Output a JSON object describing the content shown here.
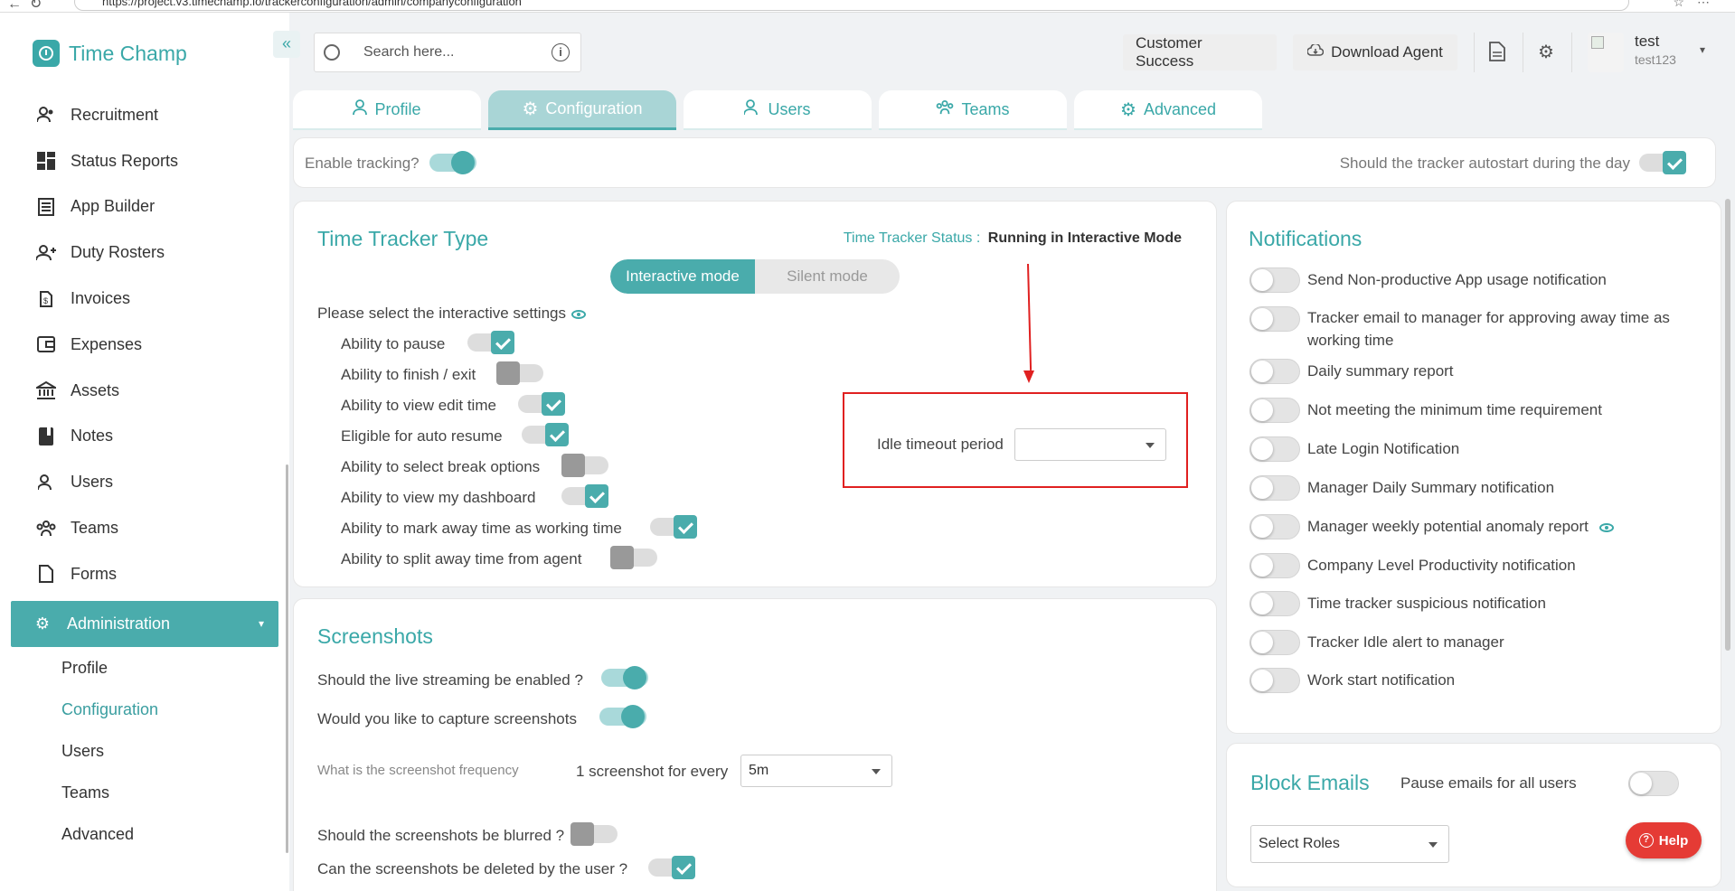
{
  "browser": {
    "url": "https://project.v3.timechamp.io/trackerconfiguration/admin/companyconfiguration"
  },
  "brand": {
    "name": "Time Champ"
  },
  "sidebar": {
    "items": [
      {
        "label": "Recruitment",
        "icon": "recruitment-icon"
      },
      {
        "label": "Status Reports",
        "icon": "status-reports-icon"
      },
      {
        "label": "App Builder",
        "icon": "app-builder-icon"
      },
      {
        "label": "Duty Rosters",
        "icon": "duty-rosters-icon"
      },
      {
        "label": "Invoices",
        "icon": "invoices-icon"
      },
      {
        "label": "Expenses",
        "icon": "expenses-icon"
      },
      {
        "label": "Assets",
        "icon": "assets-icon"
      },
      {
        "label": "Notes",
        "icon": "notes-icon"
      },
      {
        "label": "Users",
        "icon": "users-icon"
      },
      {
        "label": "Teams",
        "icon": "teams-icon"
      },
      {
        "label": "Forms",
        "icon": "forms-icon"
      }
    ],
    "active": {
      "label": "Administration",
      "icon": "gear-icon"
    },
    "sub": [
      "Profile",
      "Configuration",
      "Users",
      "Teams",
      "Advanced"
    ]
  },
  "header": {
    "search_placeholder": "Search here...",
    "customer_success": "Customer Success",
    "download_agent": "Download Agent",
    "user_name": "test",
    "user_id": "test123"
  },
  "tabs": [
    "Profile",
    "Configuration",
    "Users",
    "Teams",
    "Advanced"
  ],
  "tracking": {
    "enable_label": "Enable tracking?",
    "autostart_label": "Should the tracker autostart during the day"
  },
  "tracker_type": {
    "title": "Time Tracker Type",
    "status_label": "Time Tracker Status :",
    "status_value": "Running in Interactive Mode",
    "modes": [
      "Interactive mode",
      "Silent mode"
    ],
    "settings_label": "Please select the interactive settings",
    "settings": [
      {
        "label": "Ability to pause",
        "state": "check"
      },
      {
        "label": "Ability to finish / exit",
        "state": "off"
      },
      {
        "label": "Ability to view edit time",
        "state": "check"
      },
      {
        "label": "Eligible for auto resume",
        "state": "check"
      },
      {
        "label": "Ability to select break options",
        "state": "off"
      },
      {
        "label": "Ability to view my dashboard",
        "state": "check"
      },
      {
        "label": "Ability to mark away time as working time",
        "state": "check"
      },
      {
        "label": "Ability to split away time from agent",
        "state": "off"
      }
    ],
    "idle_label": "Idle timeout period",
    "idle_value": ""
  },
  "screenshots": {
    "title": "Screenshots",
    "live_streaming": "Should the live streaming be enabled ?",
    "capture": "Would you like to capture screenshots",
    "frequency_label": "What is the screenshot frequency",
    "every_label": "1 screenshot for every",
    "frequency_value": "5m",
    "blurred": "Should the screenshots be blurred ?",
    "deleted": "Can the screenshots be deleted by the user ?"
  },
  "notifications": {
    "title": "Notifications",
    "items": [
      "Send Non-productive App usage notification",
      "Tracker email to manager for approving away time as working time",
      "Daily summary report",
      "Not meeting the minimum time requirement",
      "Late Login Notification",
      "Manager Daily Summary notification",
      "Manager weekly potential anomaly report",
      "Company Level Productivity notification",
      "Time tracker suspicious notification",
      "Tracker Idle alert to manager",
      "Work start notification"
    ]
  },
  "block_emails": {
    "title": "Block Emails",
    "pause_label": "Pause emails for all users",
    "roles_value": "Select Roles"
  },
  "help": {
    "label": "Help"
  },
  "colors": {
    "accent": "#4aacac",
    "annotation": "#e02020",
    "help": "#e53b35"
  }
}
